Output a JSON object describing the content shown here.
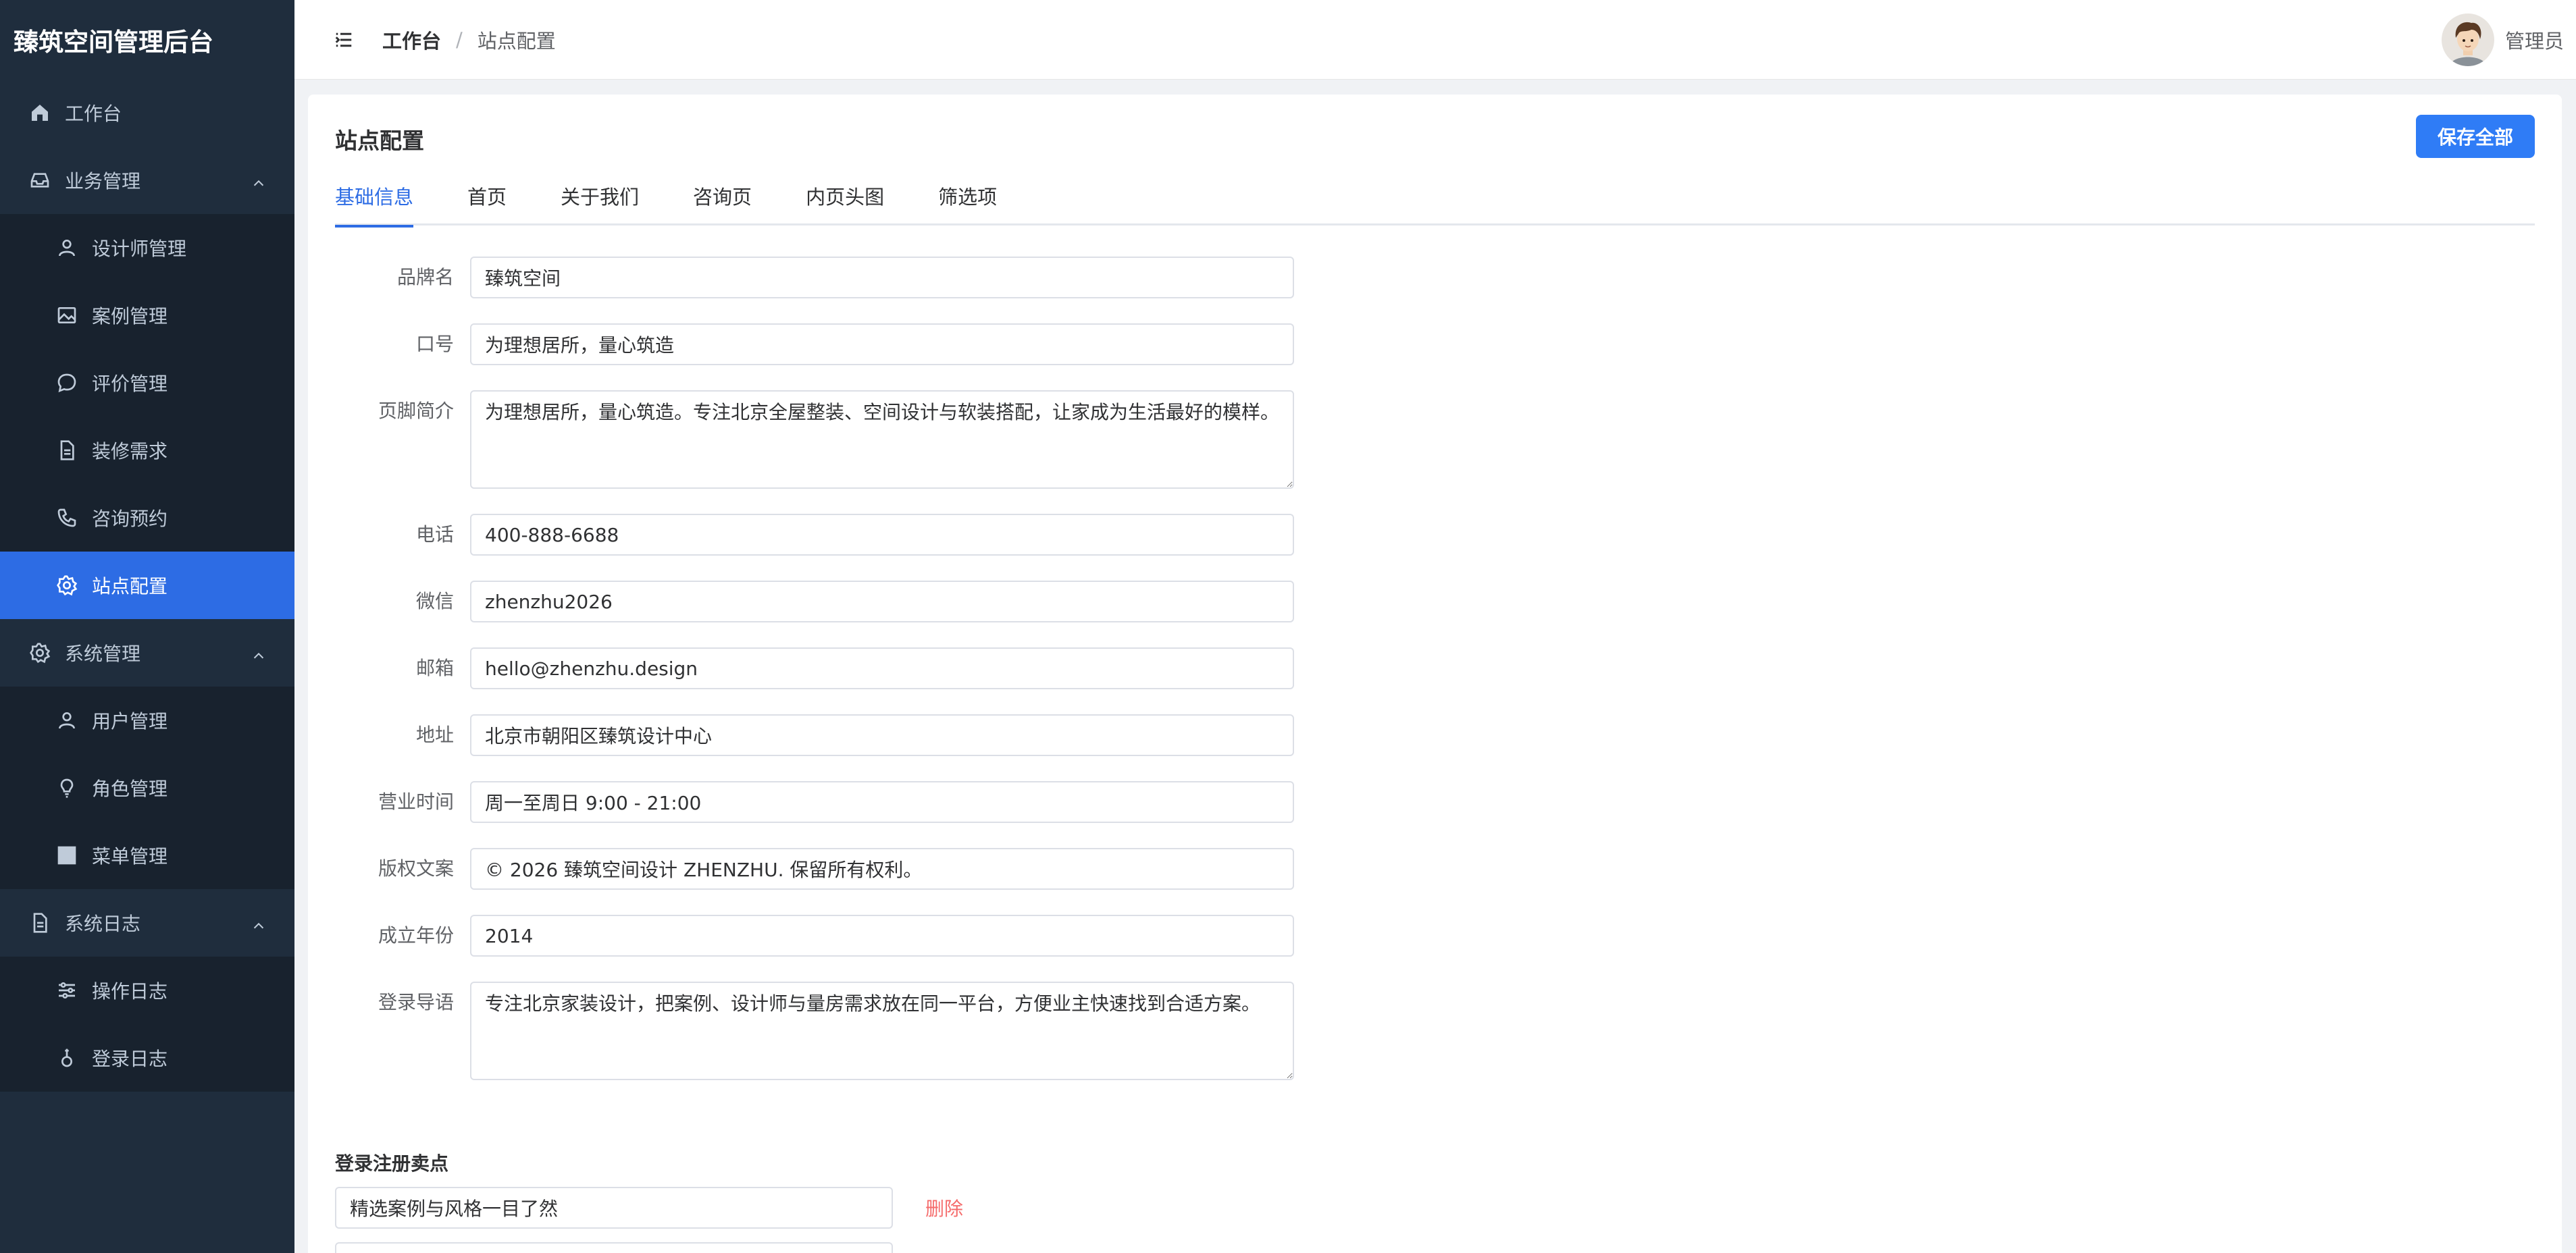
{
  "app": {
    "title": "臻筑空间管理后台"
  },
  "sidebar": {
    "items": [
      {
        "label": "工作台",
        "icon": "home-icon",
        "level": "top"
      },
      {
        "label": "业务管理",
        "icon": "inbox-icon",
        "level": "top",
        "expanded": true
      },
      {
        "label": "设计师管理",
        "icon": "user-icon",
        "level": "sub"
      },
      {
        "label": "案例管理",
        "icon": "image-icon",
        "level": "sub"
      },
      {
        "label": "评价管理",
        "icon": "chat-icon",
        "level": "sub"
      },
      {
        "label": "装修需求",
        "icon": "document-icon",
        "level": "sub"
      },
      {
        "label": "咨询预约",
        "icon": "phone-icon",
        "level": "sub"
      },
      {
        "label": "站点配置",
        "icon": "gear-icon",
        "level": "sub",
        "active": true
      },
      {
        "label": "系统管理",
        "icon": "gear-icon",
        "level": "top",
        "expanded": true
      },
      {
        "label": "用户管理",
        "icon": "user-icon",
        "level": "sub"
      },
      {
        "label": "角色管理",
        "icon": "bulb-icon",
        "level": "sub"
      },
      {
        "label": "菜单管理",
        "icon": "grid-icon",
        "level": "sub"
      },
      {
        "label": "系统日志",
        "icon": "document-icon",
        "level": "top",
        "expanded": true
      },
      {
        "label": "操作日志",
        "icon": "sliders-icon",
        "level": "sub"
      },
      {
        "label": "登录日志",
        "icon": "pin-icon",
        "level": "sub"
      }
    ]
  },
  "header": {
    "breadcrumb": [
      "工作台",
      "/",
      "站点配置"
    ],
    "user_name": "管理员"
  },
  "page": {
    "title": "站点配置",
    "save_label": "保存全部",
    "tabs": [
      "基础信息",
      "首页",
      "关于我们",
      "咨询页",
      "内页头图",
      "筛选项"
    ],
    "active_tab": "基础信息"
  },
  "form": {
    "brand_label": "品牌名",
    "brand_value": "臻筑空间",
    "slogan_label": "口号",
    "slogan_value": "为理想居所，量心筑造",
    "footer_label": "页脚简介",
    "footer_value": "为理想居所，量心筑造。专注北京全屋整装、空间设计与软装搭配，让家成为生活最好的模样。",
    "phone_label": "电话",
    "phone_value": "400-888-6688",
    "wechat_label": "微信",
    "wechat_value": "zhenzhu2026",
    "email_label": "邮箱",
    "email_value": "hello@zhenzhu.design",
    "address_label": "地址",
    "address_value": "北京市朝阳区臻筑设计中心",
    "hours_label": "营业时间",
    "hours_value": "周一至周日 9:00 - 21:00",
    "copyright_label": "版权文案",
    "copyright_value": "© 2026 臻筑空间设计 ZHENZHU. 保留所有权利。",
    "founded_label": "成立年份",
    "founded_value": "2014",
    "login_label": "登录导语",
    "login_value": "专注北京家装设计，把案例、设计师与量房需求放在同一平台，方便业主快速找到合适方案。"
  },
  "selling_points": {
    "title": "登录注册卖点",
    "delete_label": "删除",
    "items": [
      "精选案例与风格一目了然",
      ""
    ]
  },
  "colors": {
    "sidebar_bg": "#1f2d3d",
    "accent": "#2d6ce4",
    "danger": "#f56c6c"
  }
}
